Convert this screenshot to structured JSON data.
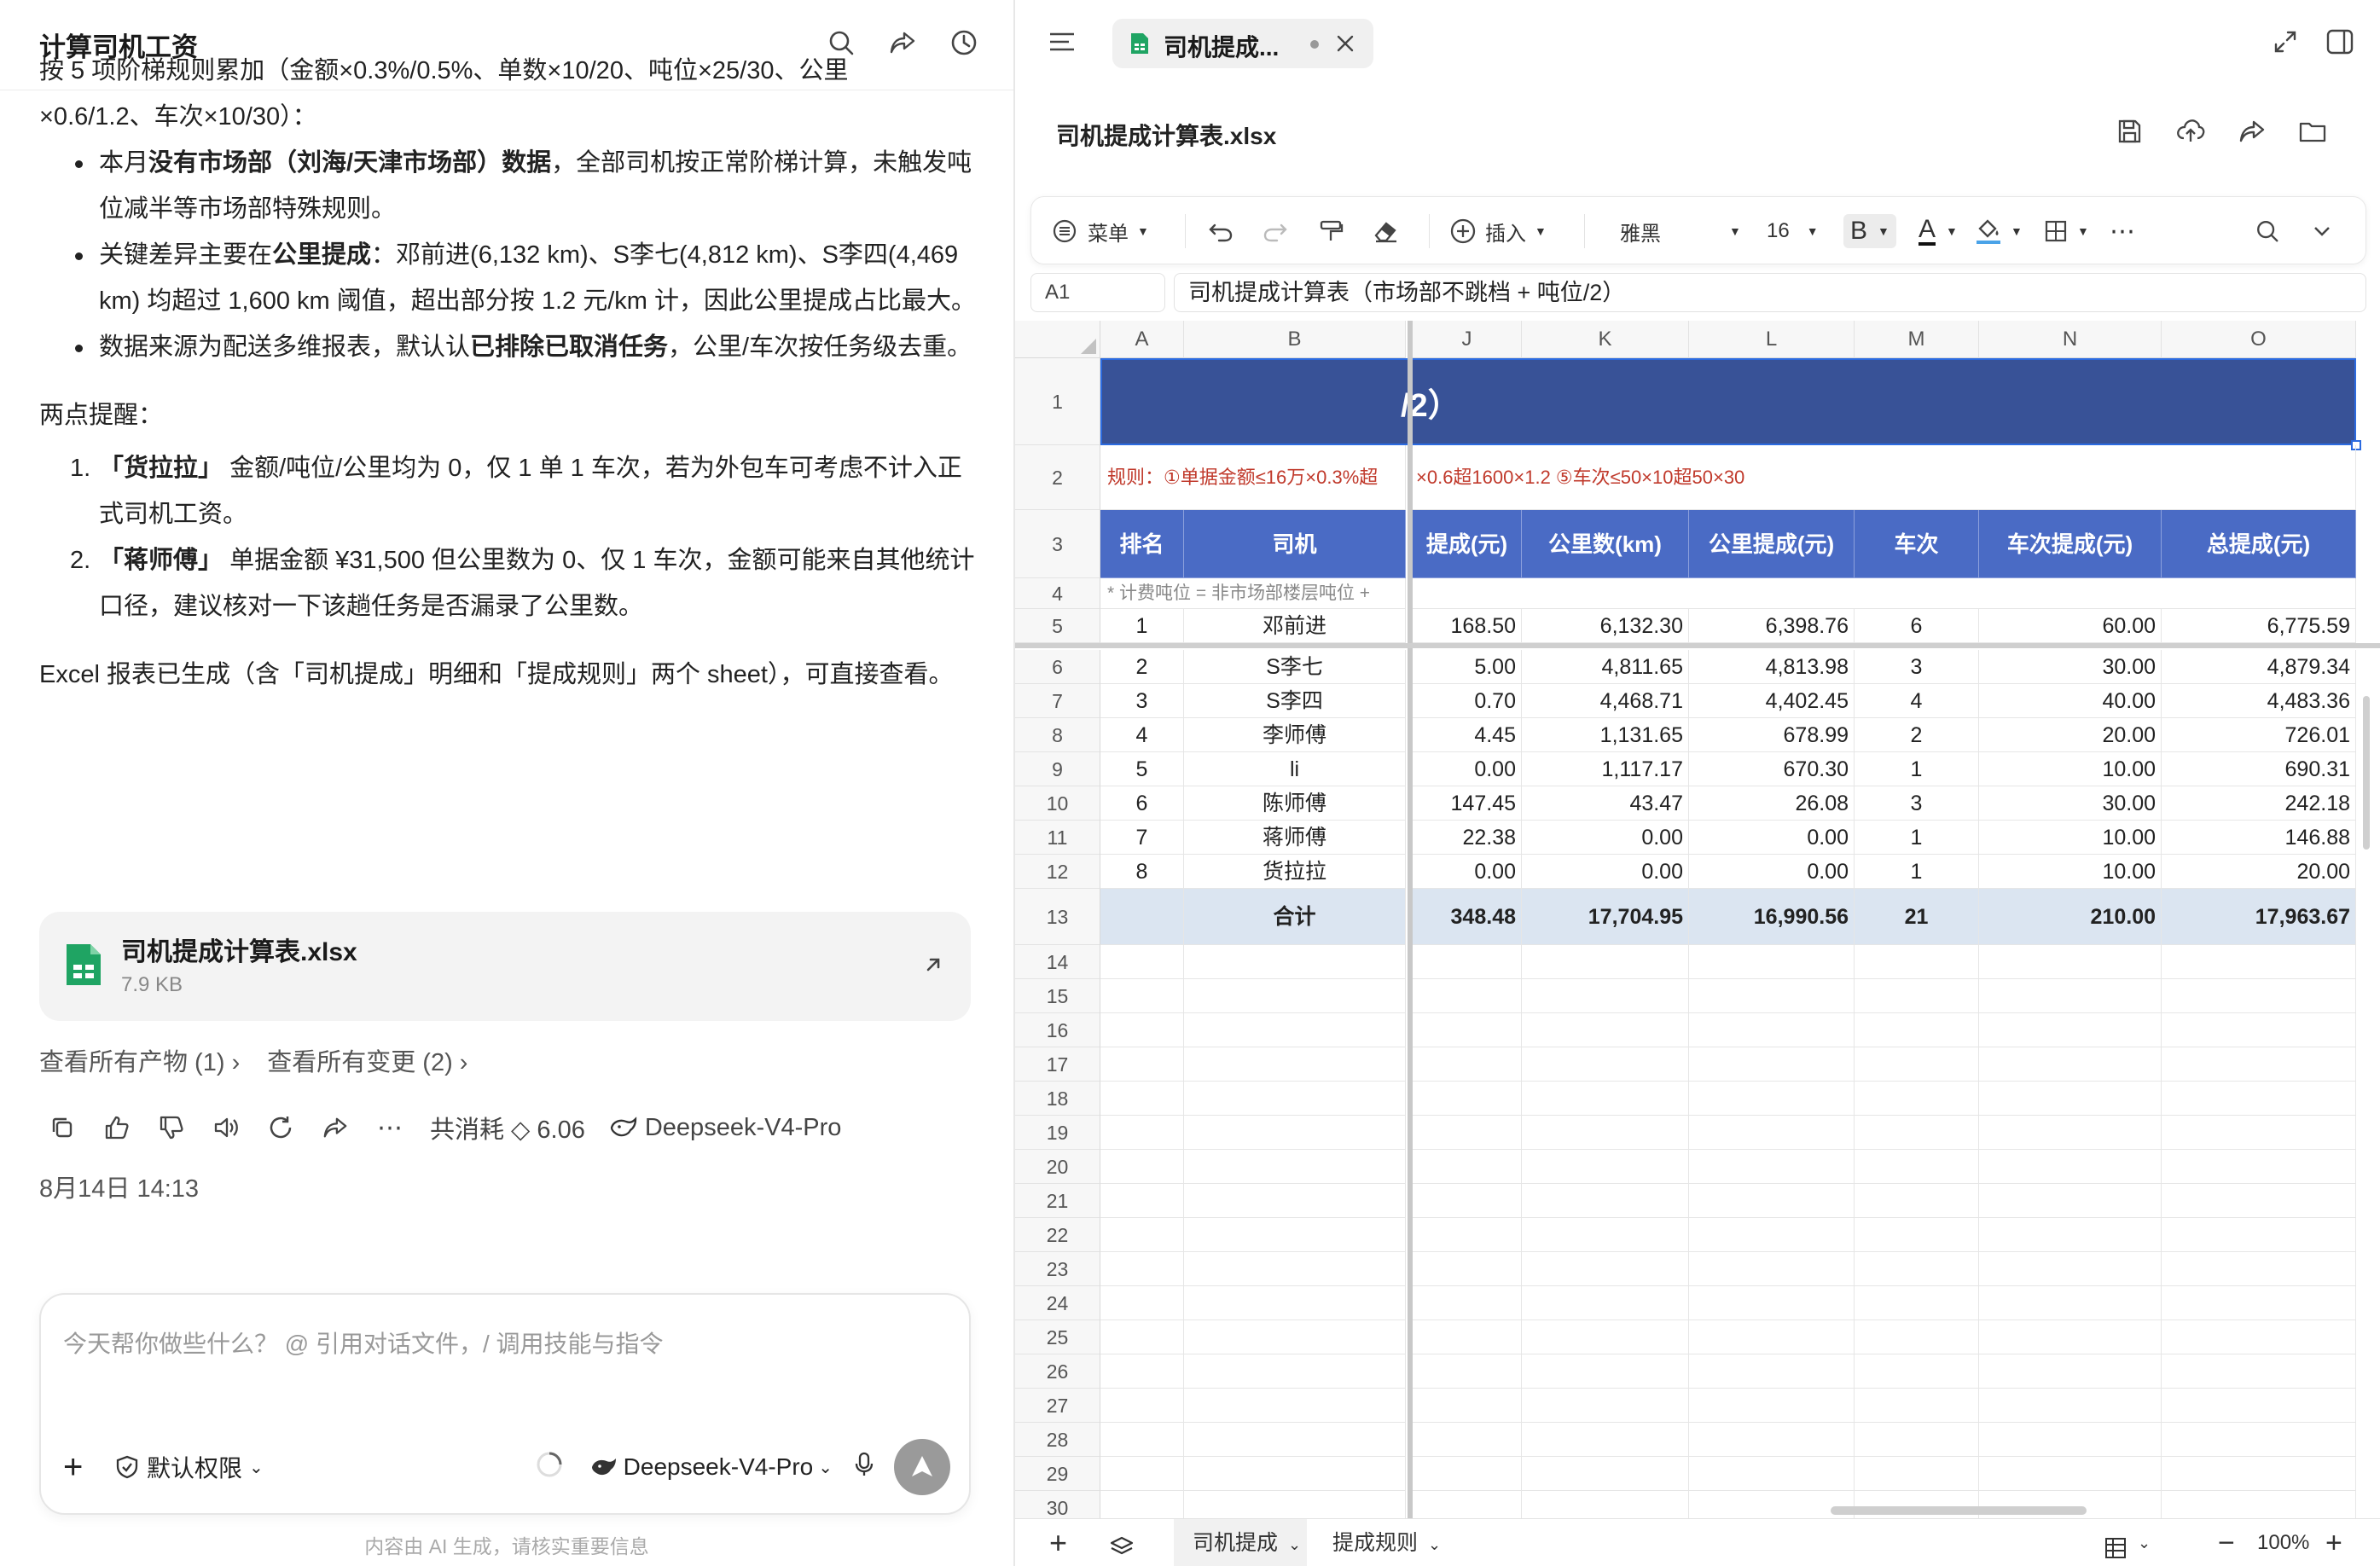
{
  "left": {
    "title": "计算司机工资",
    "intro_line1": "按 5 项阶梯规则累加（金额×0.3%/0.5%、单数×10/20、吨位×25/30、公里",
    "intro_line2": "×0.6/1.2、车次×10/30）：",
    "bullets": [
      {
        "pre": "本月",
        "bold": "没有市场部（刘海/天津市场部）数据",
        "post": "，全部司机按正常阶梯计算，未触发吨位减半等市场部特殊规则。"
      },
      {
        "pre": "关键差异主要在",
        "bold": "公里提成",
        "post": "：邓前进(6,132 km)、S李七(4,812 km)、S李四(4,469 km) 均超过 1,600 km 阈值，超出部分按 1.2 元/km 计，因此公里提成占比最大。"
      },
      {
        "pre": "数据来源为配送多维报表，默认认",
        "bold": "已排除已取消任务",
        "post": "，公里/车次按任务级去重。"
      }
    ],
    "reminder_title": "两点提醒：",
    "reminders": [
      {
        "num": "1.",
        "bold": "「货拉拉」",
        "text": " 金额/吨位/公里均为 0，仅 1 单 1 车次，若为外包车可考虑不计入正式司机工资。"
      },
      {
        "num": "2.",
        "bold": "「蒋师傅」",
        "text": " 单据金额 ¥31,500 但公里数为 0、仅 1 车次，金额可能来自其他统计口径，建议核对一下该趟任务是否漏录了公里数。"
      }
    ],
    "closing": "Excel 报表已生成（含「司机提成」明细和「提成规则」两个 sheet），可直接查看。",
    "file": {
      "name": "司机提成计算表.xlsx",
      "size": "7.9 KB"
    },
    "link_artifacts": "查看所有产物 (1)",
    "link_changes": "查看所有变更 (2)",
    "cost": "共消耗 ◇ 6.06",
    "model_label": "Deepseek-V4-Pro",
    "timestamp": "8月14日 14:13",
    "composer_placeholder": "今天帮你做些什么？ @ 引用对话文件，/ 调用技能与指令",
    "permission": "默认权限",
    "composer_model": "Deepseek-V4-Pro",
    "footnote": "内容由 AI 生成，请核实重要信息"
  },
  "right": {
    "tab_title": "司机提成...",
    "file_title": "司机提成计算表.xlsx",
    "toolbar": {
      "menu": "菜单",
      "insert": "插入",
      "font": "雅黑",
      "size": "16",
      "bold": "B",
      "fontcolor": "A"
    },
    "cell_ref": "A1",
    "formula": "司机提成计算表（市场部不跳档 + 吨位/2）",
    "columns": [
      "A",
      "B",
      "J",
      "K",
      "L",
      "M",
      "N",
      "O"
    ],
    "title_visible": "/2）",
    "rule_text": "规则：①单据金额≤16万×0.3%超",
    "rule_text2": "×0.6超1600×1.2 ⑤车次≤50×10超50×30",
    "headers": [
      "排名",
      "司机",
      "提成(元)",
      "公里数(km)",
      "公里提成(元)",
      "车次",
      "车次提成(元)",
      "总提成(元)"
    ],
    "note": "* 计费吨位 = 非市场部楼层吨位 +",
    "rows": [
      [
        "1",
        "邓前进",
        "168.50",
        "6,132.30",
        "6,398.76",
        "6",
        "60.00",
        "6,775.59"
      ],
      [
        "2",
        "S李七",
        "5.00",
        "4,811.65",
        "4,813.98",
        "3",
        "30.00",
        "4,879.34"
      ],
      [
        "3",
        "S李四",
        "0.70",
        "4,468.71",
        "4,402.45",
        "4",
        "40.00",
        "4,483.36"
      ],
      [
        "4",
        "李师傅",
        "4.45",
        "1,131.65",
        "678.99",
        "2",
        "20.00",
        "726.01"
      ],
      [
        "5",
        "li",
        "0.00",
        "1,117.17",
        "670.30",
        "1",
        "10.00",
        "690.31"
      ],
      [
        "6",
        "陈师傅",
        "147.45",
        "43.47",
        "26.08",
        "3",
        "30.00",
        "242.18"
      ],
      [
        "7",
        "蒋师傅",
        "22.38",
        "0.00",
        "0.00",
        "1",
        "10.00",
        "146.88"
      ],
      [
        "8",
        "货拉拉",
        "0.00",
        "0.00",
        "0.00",
        "1",
        "10.00",
        "20.00"
      ]
    ],
    "total": [
      "",
      "合计",
      "348.48",
      "17,704.95",
      "16,990.56",
      "21",
      "210.00",
      "17,963.67"
    ],
    "row_numbers": [
      "1",
      "2",
      "3",
      "4",
      "5",
      "6",
      "7",
      "8",
      "9",
      "10",
      "11",
      "12",
      "13",
      "14",
      "15",
      "16",
      "17",
      "18",
      "19",
      "20",
      "21",
      "22",
      "23",
      "24",
      "25",
      "26",
      "27",
      "28",
      "29",
      "30"
    ],
    "sheet_tabs": [
      "司机提成",
      "提成规则"
    ],
    "zoom": "100%"
  }
}
